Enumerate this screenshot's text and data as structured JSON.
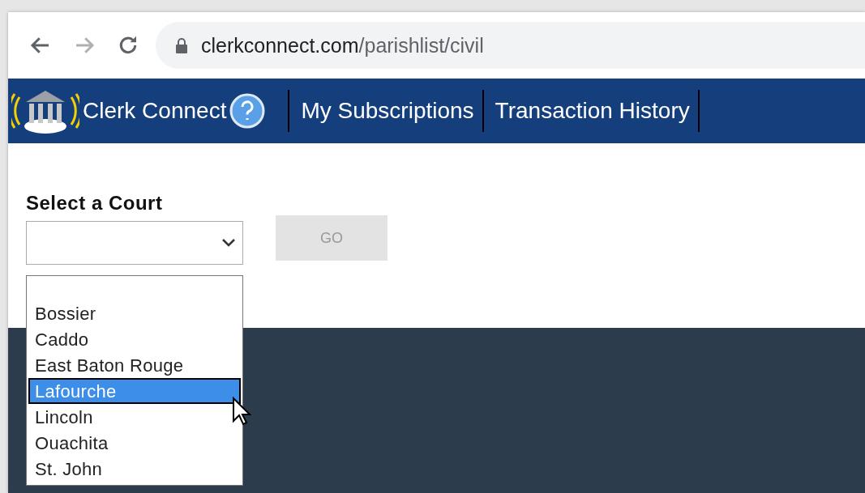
{
  "browser": {
    "nav_buttons": [
      {
        "kind": "back",
        "disabled": false
      },
      {
        "kind": "forward",
        "disabled": true
      },
      {
        "kind": "reload",
        "disabled": false
      }
    ],
    "url": {
      "domain": "clerkconnect.com",
      "path": "/parishlist/civil"
    }
  },
  "navbar": {
    "brand": "Clerk Connect",
    "links": [
      "My Subscriptions",
      "Transaction History"
    ]
  },
  "form": {
    "label": "Select a Court",
    "go_button": {
      "label": "GO",
      "disabled": true
    }
  },
  "dropdown": {
    "options": [
      {
        "label": "Bossier",
        "selected": false
      },
      {
        "label": "Caddo",
        "selected": false
      },
      {
        "label": "East Baton Rouge",
        "selected": false
      },
      {
        "label": "Lafourche",
        "selected": true
      },
      {
        "label": "Lincoln",
        "selected": false
      },
      {
        "label": "Ouachita",
        "selected": false
      },
      {
        "label": "St. John",
        "selected": false
      }
    ]
  }
}
